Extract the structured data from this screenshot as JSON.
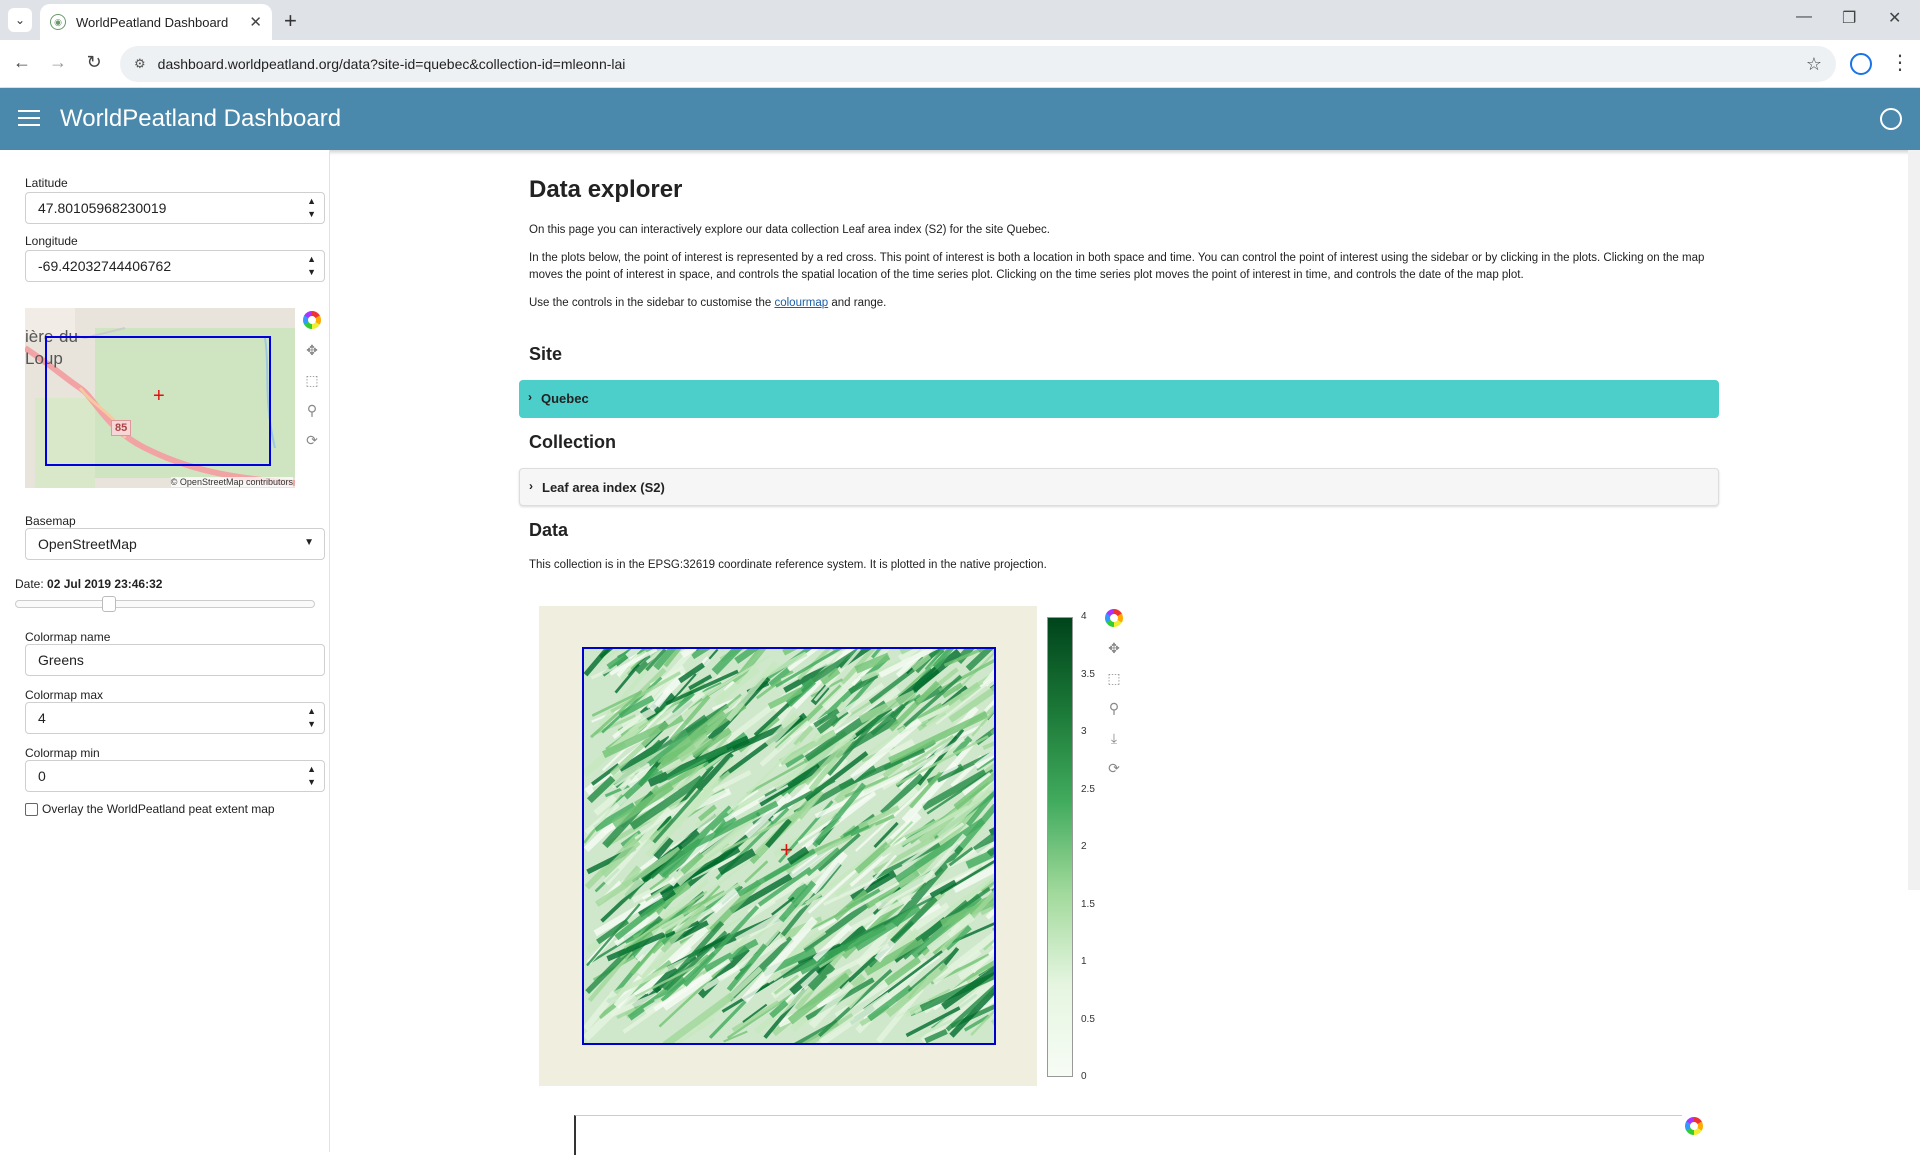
{
  "browser": {
    "tab_title": "WorldPeatland Dashboard",
    "url": "dashboard.worldpeatland.org/data?site-id=quebec&collection-id=mleonn-lai"
  },
  "app": {
    "title": "WorldPeatland Dashboard"
  },
  "sidebar": {
    "latitude_label": "Latitude",
    "latitude_value": "47.80105968230019",
    "longitude_label": "Longitude",
    "longitude_value": "-69.42032744406762",
    "minimap": {
      "place_label": "ière-du-\nLoup",
      "road_shield": "85",
      "attribution": "© OpenStreetMap contributors"
    },
    "basemap_label": "Basemap",
    "basemap_value": "OpenStreetMap",
    "date_label": "Date:",
    "date_value": "02 Jul 2019 23:46:32",
    "date_slider_fraction": 0.3,
    "colormap_name_label": "Colormap name",
    "colormap_name_value": "Greens",
    "colormap_max_label": "Colormap max",
    "colormap_max_value": "4",
    "colormap_min_label": "Colormap min",
    "colormap_min_value": "0",
    "overlay_label": "Overlay the WorldPeatland peat extent map"
  },
  "main": {
    "heading": "Data explorer",
    "intro_p1": "On this page you can interactively explore our data collection Leaf area index (S2) for the site Quebec.",
    "intro_p2": "In the plots below, the point of interest is represented by a red cross. This point of interest is both a location in both space and time. You can control the point of interest using the sidebar or by clicking in the plots. Clicking on the map moves the point of interest in space, and controls the spatial location of the time series plot. Clicking on the time series plot moves the point of interest in time, and controls the date of the map plot.",
    "intro_p3_before": "Use the controls in the sidebar to customise the ",
    "intro_p3_link": "colourmap",
    "intro_p3_after": " and range.",
    "site_heading": "Site",
    "site_value": "Quebec",
    "collection_heading": "Collection",
    "collection_value": "Leaf area index (S2)",
    "data_heading": "Data",
    "data_text": "This collection is in the EPSG:32619 coordinate reference system. It is plotted in the native projection.",
    "colorbar_ticks": [
      "4",
      "3.5",
      "3",
      "2.5",
      "2",
      "1.5",
      "1",
      "0.5",
      "0"
    ]
  },
  "colors": {
    "header": "#4a89ac",
    "site_accordion": "#4ccfcb",
    "selection": "#0000dd",
    "poi_cross": "#e01010"
  }
}
